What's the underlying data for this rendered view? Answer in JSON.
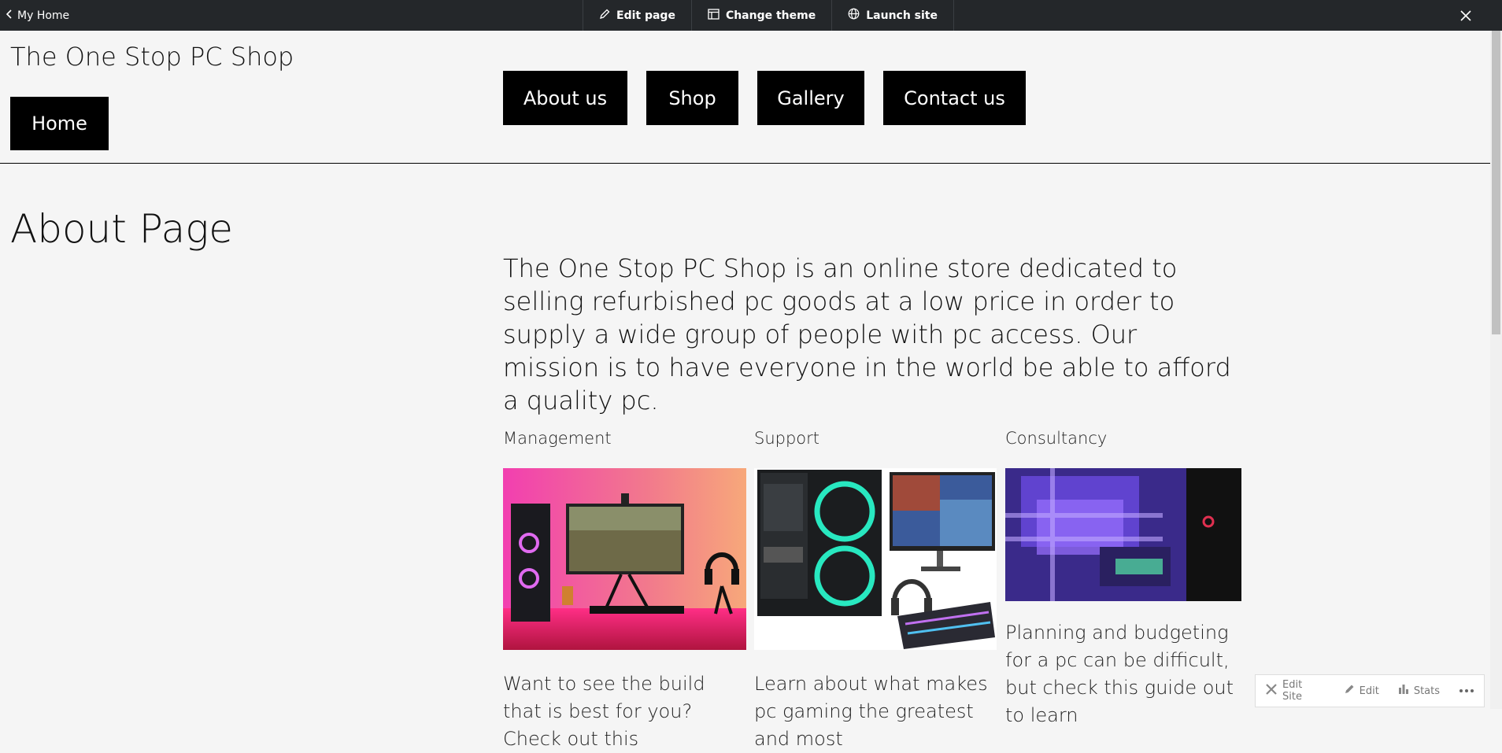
{
  "adminbar": {
    "back_label": "My Home",
    "edit_label": "Edit page",
    "theme_label": "Change theme",
    "launch_label": "Launch site"
  },
  "site": {
    "title": "The One Stop PC Shop",
    "nav": {
      "home": "Home",
      "about": "About us",
      "shop": "Shop",
      "gallery": "Gallery",
      "contact": "Contact us"
    }
  },
  "page": {
    "heading": "About Page",
    "intro": "The One Stop PC Shop is an online store dedicated to selling refurbished pc goods at a low price in order to supply a wide group of people with pc access. Our mission is to have everyone in the world be able to afford a quality pc.",
    "columns": [
      {
        "heading": "Management",
        "text": "Want to see the build that is best for you? Check out this"
      },
      {
        "heading": "Support",
        "text": "Learn about what makes pc gaming the greatest and most"
      },
      {
        "heading": "Consultancy",
        "text": "Planning and budgeting for a pc can be difficult, but check this guide out to learn"
      }
    ]
  },
  "toolbar": {
    "edit_site": "Edit Site",
    "edit": "Edit",
    "stats": "Stats"
  },
  "colors": {
    "adminbar": "#24272a",
    "nav_button": "#000000",
    "background": "#f5f5f5"
  }
}
